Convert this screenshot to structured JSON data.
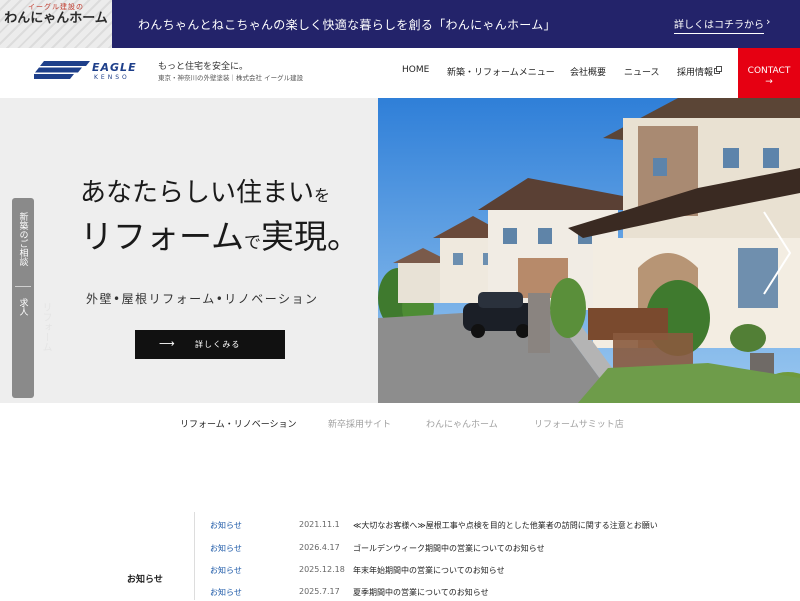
{
  "topbar": {
    "logo_small": "イーグル建設の",
    "logo_main": "わんにゃんホーム",
    "message": "わんちゃんとねこちゃんの楽しく快適な暮らしを創る「わんにゃんホーム」",
    "link_label": "詳しくはコチラから",
    "chevron": "›"
  },
  "header": {
    "brand_word": "EAGLE",
    "brand_sub": "KENSO",
    "tagline": "もっと住宅を安全に。",
    "tagline_sub": "東京・神奈川の外壁塗装｜株式会社 イーグル建設",
    "nav": [
      "HOME",
      "新築・リフォームメニュー",
      "会社概要",
      "ニュース",
      "採用情報"
    ],
    "nav_recruit_icon": "external-link-icon",
    "contact_label": "CONTACT",
    "contact_arrow": "→"
  },
  "side_tabs": [
    "新築のご相談",
    "求人"
  ],
  "side_ghost": "リフォーム",
  "hero": {
    "line1_main": "あなたらしい住まい",
    "line1_particle": "を",
    "line2_a": "リフォーム",
    "line2_particle": "で",
    "line2_b": "実現。",
    "subtitle": "外壁•屋根リフォーム•リノベーション",
    "button_label": "詳しくみる",
    "button_arrow": "⟶",
    "photo_subject": "residential-street-houses-photo"
  },
  "categories": {
    "items": [
      "リフォーム・リノベーション",
      "新卒採用サイト",
      "わんにゃんホーム",
      "リフォームサミット店"
    ],
    "active_index": 0
  },
  "news": {
    "label": "お知らせ",
    "items": [
      {
        "category": "お知らせ",
        "date": "2021.11.1",
        "title": "≪大切なお客様へ≫屋根工事や点検を目的とした他業者の訪問に関する注意とお願い"
      },
      {
        "category": "お知らせ",
        "date": "2026.4.17",
        "title": "ゴールデンウィーク期間中の営業についてのお知らせ"
      },
      {
        "category": "お知らせ",
        "date": "2025.12.18",
        "title": "年末年始期間中の営業についてのお知らせ"
      },
      {
        "category": "お知らせ",
        "date": "2025.7.17",
        "title": "夏季期間中の営業についてのお知らせ"
      }
    ]
  },
  "colors": {
    "topbar_bg": "#23236a",
    "brand_blue": "#1e3f8a",
    "contact_red": "#e60012",
    "hero_bg": "#eeeeee",
    "news_category": "#1e5aa8"
  }
}
